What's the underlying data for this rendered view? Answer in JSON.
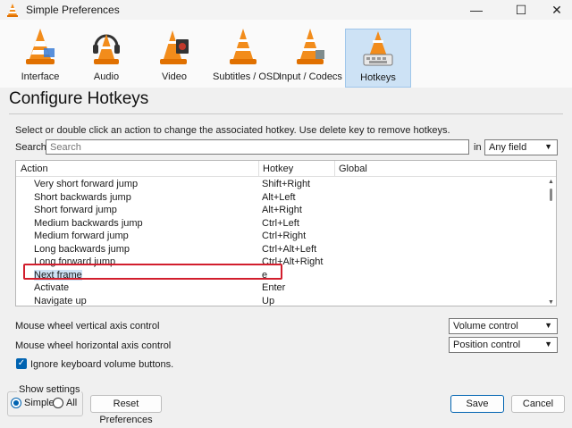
{
  "window": {
    "title": "Simple Preferences",
    "minimize": "—",
    "maximize": "☐",
    "close": "✕"
  },
  "toolbar": {
    "items": [
      {
        "label": "Interface"
      },
      {
        "label": "Audio"
      },
      {
        "label": "Video"
      },
      {
        "label": "Subtitles / OSD"
      },
      {
        "label": "Input / Codecs"
      },
      {
        "label": "Hotkeys"
      }
    ],
    "active": "Hotkeys"
  },
  "page": {
    "heading": "Configure Hotkeys",
    "hint": "Select or double click an action to change the associated hotkey. Use delete key to remove hotkeys."
  },
  "search": {
    "label": "Search",
    "placeholder": "Search",
    "in_label": "in",
    "scope": "Any field"
  },
  "table": {
    "columns": [
      "Action",
      "Hotkey",
      "Global"
    ],
    "rows": [
      {
        "action": "Very short forward jump",
        "hotkey": "Shift+Right"
      },
      {
        "action": "Short backwards jump",
        "hotkey": "Alt+Left"
      },
      {
        "action": "Short forward jump",
        "hotkey": "Alt+Right"
      },
      {
        "action": "Medium backwards jump",
        "hotkey": "Ctrl+Left"
      },
      {
        "action": "Medium forward jump",
        "hotkey": "Ctrl+Right"
      },
      {
        "action": "Long backwards jump",
        "hotkey": "Ctrl+Alt+Left"
      },
      {
        "action": "Long forward jump",
        "hotkey": "Ctrl+Alt+Right"
      },
      {
        "action": "Next frame",
        "hotkey": "e"
      },
      {
        "action": "Activate",
        "hotkey": "Enter"
      },
      {
        "action": "Navigate up",
        "hotkey": "Up"
      }
    ],
    "selected": "Next frame"
  },
  "mouse": {
    "vertical_label": "Mouse wheel vertical axis control",
    "vertical_value": "Volume control",
    "horizontal_label": "Mouse wheel horizontal axis control",
    "horizontal_value": "Position control"
  },
  "ignore_volume": {
    "label": "Ignore keyboard volume buttons.",
    "checked": true
  },
  "show_settings": {
    "title": "Show settings",
    "simple": "Simple",
    "all": "All",
    "selected": "Simple"
  },
  "buttons": {
    "reset": "Reset Preferences",
    "save": "Save",
    "cancel": "Cancel"
  },
  "colors": {
    "accent": "#0063b1",
    "highlight_box": "#d21e2d",
    "active_tab": "#cde2f5"
  }
}
